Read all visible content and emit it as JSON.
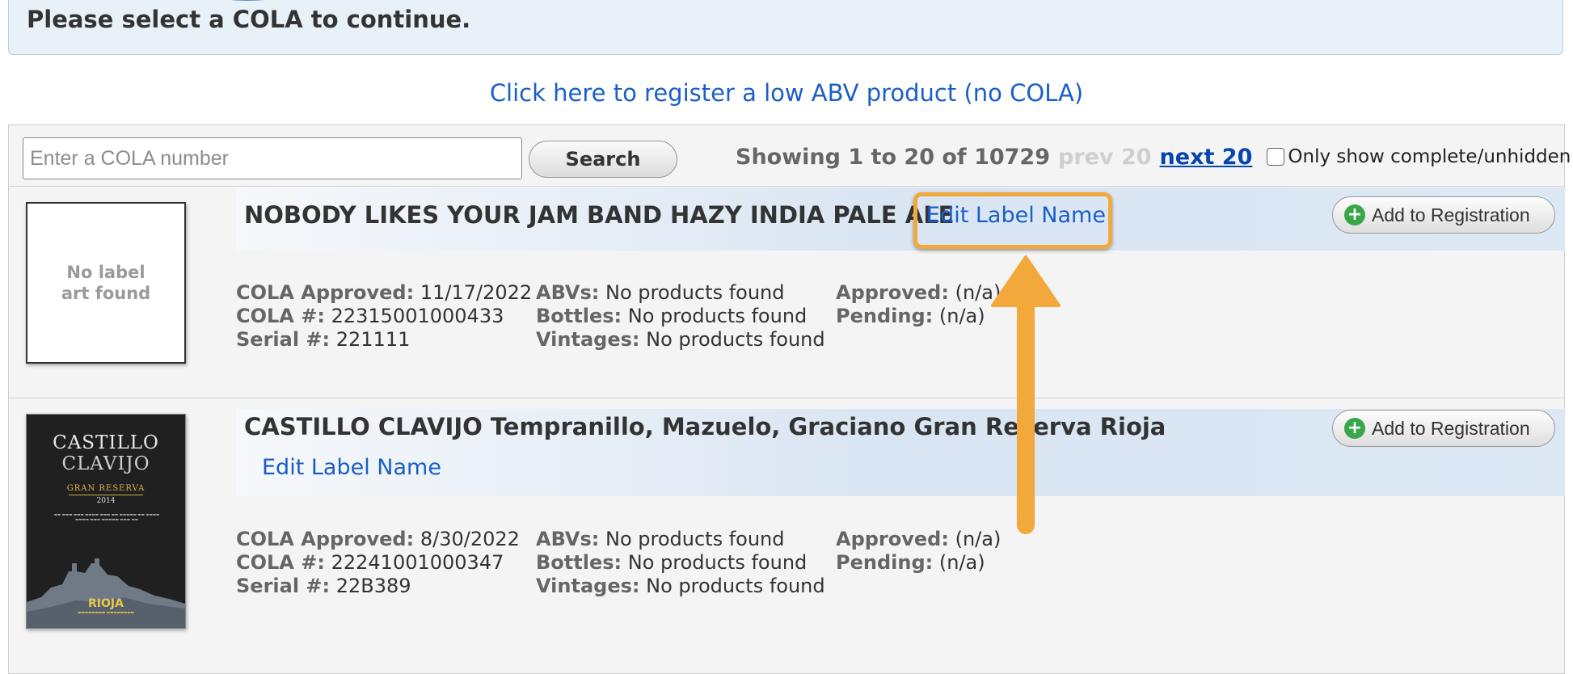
{
  "notice": {
    "text": "Please select a COLA to continue."
  },
  "register_link": "Click here to register a low ABV product (no COLA)",
  "search": {
    "placeholder": "Enter a COLA number",
    "button": "Search"
  },
  "paging": {
    "showing": "Showing 1 to 20 of 10729",
    "prev": "prev 20",
    "next": "next 20",
    "filter_label": "Only show complete/unhidden labels",
    "filter_checked": false
  },
  "labels": [
    {
      "thumbnail_text": "No label art found",
      "title": "NOBODY LIKES YOUR JAM BAND HAZY INDIA PALE ALE",
      "edit_link": "Edit Label Name",
      "add_button": "Add to Registration",
      "details": {
        "cola_approved_label": "COLA Approved:",
        "cola_approved": "11/17/2022",
        "cola_num_label": "COLA #:",
        "cola_num": "22315001000433",
        "serial_label": "Serial #:",
        "serial": "221111",
        "abvs_label": "ABVs:",
        "abvs": "No products found",
        "bottles_label": "Bottles:",
        "bottles": "No products found",
        "vintages_label": "Vintages:",
        "vintages": "No products found",
        "approved_label": "Approved:",
        "approved": "(n/a)",
        "pending_label": "Pending:",
        "pending": "(n/a)"
      }
    },
    {
      "thumbnail_art": {
        "brand_line1": "CASTILLO",
        "brand_line2": "CLAVIJO",
        "gran_reserva": "GRAN RESERVA",
        "year": "2014",
        "region": "RIOJA"
      },
      "title": "CASTILLO CLAVIJO Tempranillo, Mazuelo, Graciano Gran Reserva Rioja",
      "edit_link": "Edit Label Name",
      "add_button": "Add to Registration",
      "details": {
        "cola_approved_label": "COLA Approved:",
        "cola_approved": "8/30/2022",
        "cola_num_label": "COLA #:",
        "cola_num": "22241001000347",
        "serial_label": "Serial #:",
        "serial": "22B389",
        "abvs_label": "ABVs:",
        "abvs": "No products found",
        "bottles_label": "Bottles:",
        "bottles": "No products found",
        "vintages_label": "Vintages:",
        "vintages": "No products found",
        "approved_label": "Approved:",
        "approved": "(n/a)",
        "pending_label": "Pending:",
        "pending": "(n/a)"
      }
    }
  ],
  "annotation": {
    "highlight_color": "#f2a83a"
  }
}
